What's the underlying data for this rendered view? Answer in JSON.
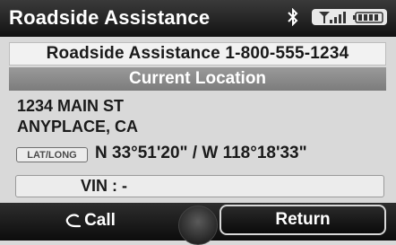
{
  "header": {
    "title": "Roadside Assistance",
    "bluetooth_icon": "bluetooth-icon",
    "signal_icon": "signal-battery-icon"
  },
  "phone": {
    "text": "Roadside Assistance  1-800-555-1234"
  },
  "location": {
    "header": "Current Location",
    "address_line1": "1234 MAIN ST",
    "address_line2": "ANYPLACE, CA",
    "latlong_label": "LAT/LONG",
    "coordinates": "N 33°51'20\" / W 118°18'33\""
  },
  "vin": {
    "text": "VIN : -"
  },
  "buttons": {
    "call_label": "Call",
    "call_icon": "phone-handset-icon",
    "return_label": "Return"
  },
  "colors": {
    "background": "#d9d9d9",
    "title_bar": "#1e1e1e",
    "section_header": "#8a8a8a"
  }
}
